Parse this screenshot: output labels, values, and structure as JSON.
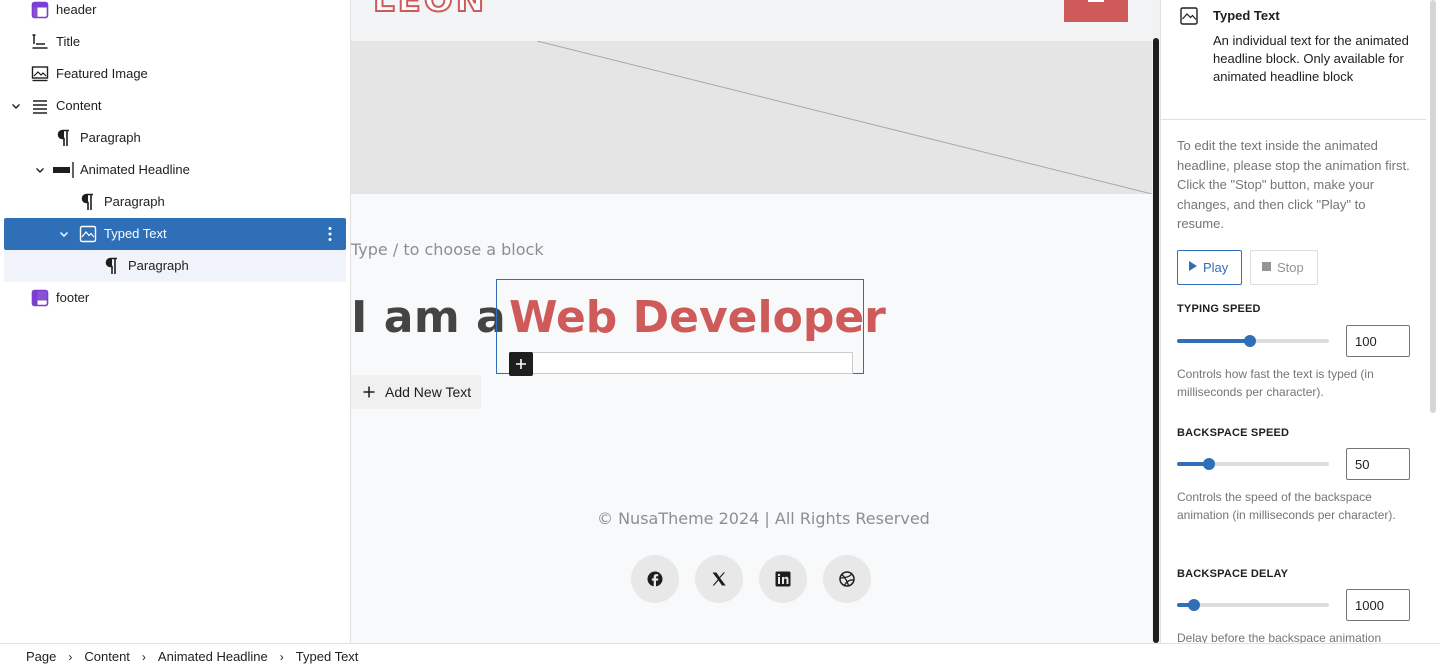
{
  "list_view": {
    "items": [
      {
        "label": "header",
        "icon": "template-part-icon"
      },
      {
        "label": "Title",
        "icon": "title-icon"
      },
      {
        "label": "Featured Image",
        "icon": "featured-image-icon"
      },
      {
        "label": "Content",
        "icon": "content-icon",
        "expanded": true
      },
      {
        "label": "Paragraph",
        "icon": "paragraph-icon"
      },
      {
        "label": "Animated Headline",
        "icon": "animated-headline-icon",
        "expanded": true
      },
      {
        "label": "Paragraph",
        "icon": "paragraph-icon"
      },
      {
        "label": "Typed Text",
        "icon": "typed-text-icon",
        "expanded": true,
        "selected": true
      },
      {
        "label": "Paragraph",
        "icon": "paragraph-icon"
      },
      {
        "label": "footer",
        "icon": "template-part-icon"
      }
    ]
  },
  "canvas": {
    "logo_text": "LEON",
    "placeholder": "Type / to choose a block",
    "headline_static": "I am a",
    "typed_text": "Web Developer",
    "add_new_text": "Add New Text",
    "copyright": "© NusaTheme 2024 | All Rights Reserved",
    "socials": [
      "facebook-icon",
      "x-icon",
      "linkedin-icon",
      "dribbble-icon"
    ],
    "accent_color": "#cf5a5a"
  },
  "inspector": {
    "title": "Typed Text",
    "description": "An individual text for the animated headline block. Only available for animated headline block",
    "help": "To edit the text inside the animated headline, please stop the animation first. Click the \"Stop\" button, make your changes, and then click \"Play\" to resume.",
    "play_label": "Play",
    "stop_label": "Stop",
    "typing_speed": {
      "label": "Typing Speed",
      "value": "100",
      "level": 0.48,
      "help": "Controls how fast the text is typed (in milliseconds per character)."
    },
    "backspace_speed": {
      "label": "Backspace Speed",
      "value": "50",
      "level": 0.21,
      "help": "Controls the speed of the backspace animation (in milliseconds per character)."
    },
    "backspace_delay": {
      "label": "Backspace Delay",
      "value": "1000",
      "level": 0.11,
      "help": "Delay before the backspace animation"
    },
    "accent_color": "#2f6fb8"
  },
  "breadcrumb": [
    "Page",
    "Content",
    "Animated Headline",
    "Typed Text"
  ]
}
